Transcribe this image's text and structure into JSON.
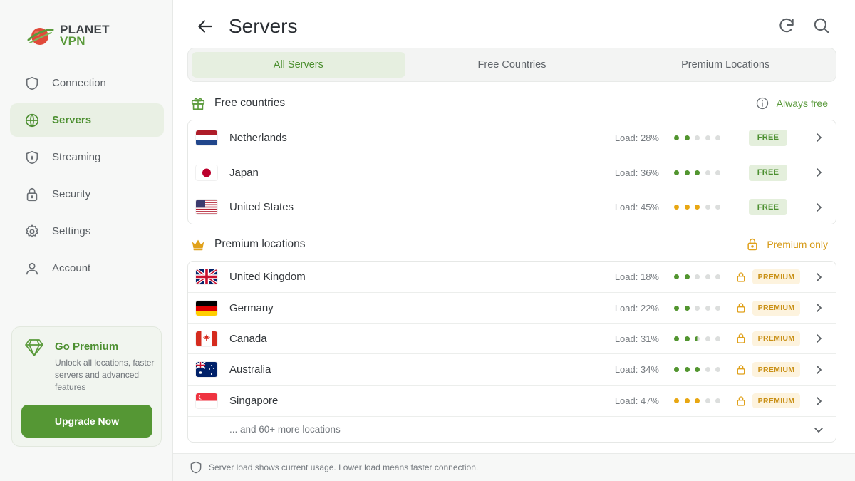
{
  "app": {
    "logo_line1": "PLANET",
    "logo_line2": "VPN"
  },
  "sidebar": {
    "items": [
      {
        "label": "Connection",
        "icon": "shield-icon"
      },
      {
        "label": "Servers",
        "icon": "globe-icon",
        "active": true
      },
      {
        "label": "Streaming",
        "icon": "shield-flame-icon"
      },
      {
        "label": "Security",
        "icon": "lock-icon"
      },
      {
        "label": "Settings",
        "icon": "gear-icon"
      },
      {
        "label": "Account",
        "icon": "user-icon"
      }
    ],
    "promo": {
      "title": "Go Premium",
      "description": "Unlock all locations, faster servers and advanced features",
      "button": "Upgrade Now",
      "icon": "diamond-icon"
    }
  },
  "header": {
    "title": "Servers",
    "icons": [
      "back-arrow-icon",
      "refresh-icon",
      "search-icon"
    ]
  },
  "tabs": [
    {
      "label": "All Servers",
      "active": true
    },
    {
      "label": "Free Countries"
    },
    {
      "label": "Premium Locations"
    }
  ],
  "free_section": {
    "title": "Free countries",
    "note": "Always free",
    "icon": "gift-icon",
    "rows": [
      {
        "country": "Netherlands",
        "flag": "nl",
        "load": "Load: 28%",
        "dots": [
          "g",
          "g",
          "e",
          "e",
          "e"
        ],
        "badge": "FREE"
      },
      {
        "country": "Japan",
        "flag": "jp",
        "load": "Load: 36%",
        "dots": [
          "g",
          "g",
          "g",
          "e",
          "e"
        ],
        "badge": "FREE"
      },
      {
        "country": "United States",
        "flag": "us",
        "load": "Load: 45%",
        "dots": [
          "y",
          "y",
          "y",
          "e",
          "e"
        ],
        "badge": "FREE"
      }
    ]
  },
  "premium_section": {
    "title": "Premium locations",
    "note": "Premium only",
    "icon": "crown-icon",
    "rows": [
      {
        "country": "United Kingdom",
        "flag": "gb",
        "load": "Load: 18%",
        "dots": [
          "g",
          "g",
          "e",
          "e",
          "e"
        ],
        "badge": "PREMIUM"
      },
      {
        "country": "Germany",
        "flag": "de",
        "load": "Load: 22%",
        "dots": [
          "g",
          "g",
          "e",
          "e",
          "e"
        ],
        "badge": "PREMIUM"
      },
      {
        "country": "Canada",
        "flag": "ca",
        "load": "Load: 31%",
        "dots": [
          "g",
          "g",
          "h",
          "e",
          "e"
        ],
        "badge": "PREMIUM"
      },
      {
        "country": "Australia",
        "flag": "au",
        "load": "Load: 34%",
        "dots": [
          "g",
          "g",
          "g",
          "e",
          "e"
        ],
        "badge": "PREMIUM"
      },
      {
        "country": "Singapore",
        "flag": "sg",
        "load": "Load: 47%",
        "dots": [
          "y",
          "y",
          "y",
          "e",
          "e"
        ],
        "badge": "PREMIUM"
      }
    ],
    "more": "... and 60+ more locations"
  },
  "footer": {
    "text": "Server load shows current usage. Lower load means faster connection."
  },
  "colors": {
    "accent": "#559734",
    "premium": "#e0a11b",
    "load_low": "#52952f",
    "load_medium": "#e8a713"
  }
}
